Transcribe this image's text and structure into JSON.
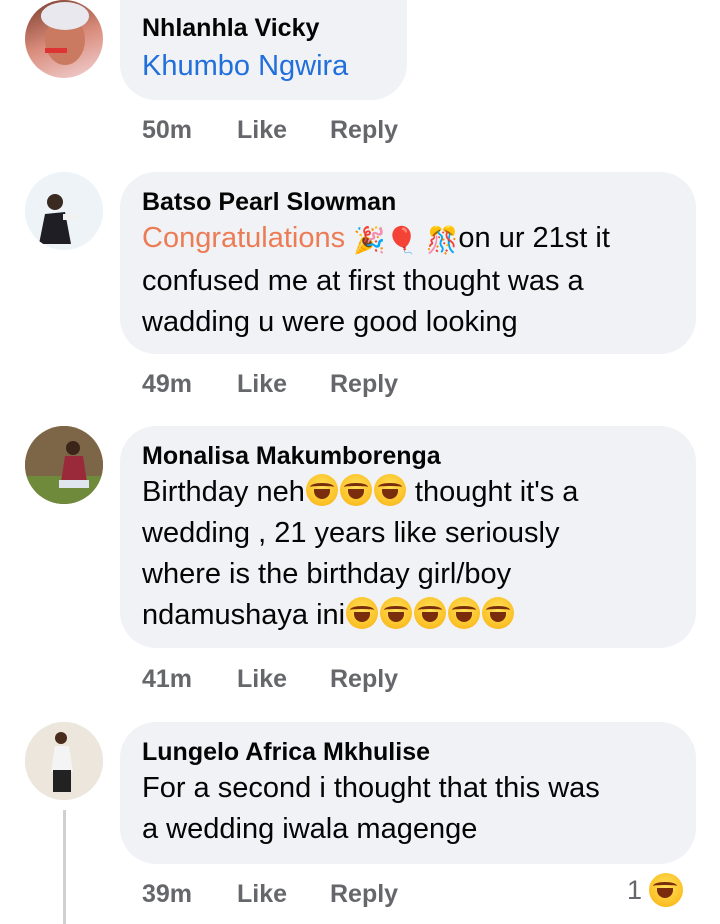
{
  "comments": [
    {
      "author": "Nhlanhla Vicky",
      "tag": "Khumbo Ngwira",
      "time": "50m",
      "like": "Like",
      "reply": "Reply"
    },
    {
      "author": "Batso Pearl Slowman",
      "highlight": "Congratulations",
      "line1_end": "on ur 21st it",
      "line2": "confused me at first thought was a",
      "line3": "wadding u were good looking",
      "emojis": [
        "party-popper-icon",
        "balloon-icon",
        "confetti-ball-icon"
      ],
      "time": "49m",
      "like": "Like",
      "reply": "Reply"
    },
    {
      "author": "Monalisa Makumborenga",
      "line1_start": "Birthday neh",
      "line1_end": "thought it's a",
      "line2": "wedding , 21 years like seriously",
      "line3": "where is the birthday girl/boy",
      "line4": "ndamushaya ini",
      "emojis": [
        "laughing-tears-icon"
      ],
      "time": "41m",
      "like": "Like",
      "reply": "Reply"
    },
    {
      "author": "Lungelo Africa Mkhulise",
      "line1": "For a second i thought that this was",
      "line2": "a wedding iwala magenge",
      "time": "39m",
      "like": "Like",
      "reply": "Reply",
      "reaction_count": "1",
      "reaction_icon": "laughing-icon"
    }
  ]
}
